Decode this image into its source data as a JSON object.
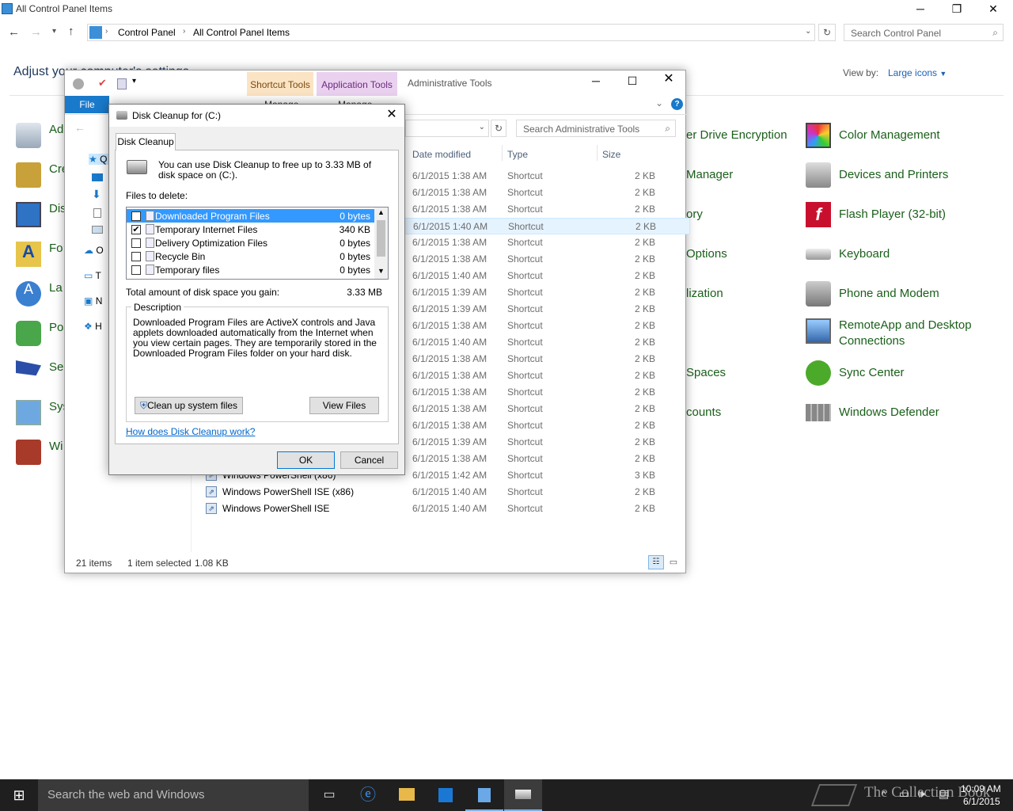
{
  "cp": {
    "title": "All Control Panel Items",
    "breadcrumb": [
      "Control Panel",
      "All Control Panel Items"
    ],
    "search_placeholder": "Search Control Panel",
    "heading": "Adjust your computer's settings",
    "view_by_label": "View by:",
    "view_by_value": "Large icons",
    "left_items": [
      "Ad",
      "Cre",
      "Dis",
      "Fo",
      "La",
      "Po",
      "Se",
      "Sys",
      "Wi"
    ],
    "mid_items": [
      "er Drive Encryption",
      "Manager",
      "ory",
      "Options",
      "lization",
      "Spaces",
      "counts"
    ],
    "right_items": [
      "Color Management",
      "Devices and Printers",
      "Flash Player (32-bit)",
      "Keyboard",
      "Phone and Modem",
      "RemoteApp and Desktop",
      "Connections",
      "Sync Center",
      "Windows Defender"
    ]
  },
  "explorer": {
    "title": "Administrative Tools",
    "tab_shortcut": "Shortcut Tools",
    "tab_app": "Application Tools",
    "file_tab": "File",
    "ribbon_sub1": "Manage",
    "ribbon_sub2": "Manage",
    "search_placeholder": "Search Administrative Tools",
    "columns": {
      "date": "Date modified",
      "type": "Type",
      "size": "Size"
    },
    "nav_letters": [
      "Q",
      "T",
      "N",
      "H",
      "O"
    ],
    "rows": [
      {
        "name": "",
        "date": "6/1/2015 1:38 AM",
        "type": "Shortcut",
        "size": "2 KB"
      },
      {
        "name": "",
        "date": "6/1/2015 1:38 AM",
        "type": "Shortcut",
        "size": "2 KB"
      },
      {
        "name": "",
        "date": "6/1/2015 1:38 AM",
        "type": "Shortcut",
        "size": "2 KB"
      },
      {
        "name": "",
        "date": "6/1/2015 1:40 AM",
        "type": "Shortcut",
        "size": "2 KB"
      },
      {
        "name": "",
        "date": "6/1/2015 1:38 AM",
        "type": "Shortcut",
        "size": "2 KB"
      },
      {
        "name": "",
        "date": "6/1/2015 1:38 AM",
        "type": "Shortcut",
        "size": "2 KB"
      },
      {
        "name": "",
        "date": "6/1/2015 1:40 AM",
        "type": "Shortcut",
        "size": "2 KB"
      },
      {
        "name": "",
        "date": "6/1/2015 1:39 AM",
        "type": "Shortcut",
        "size": "2 KB"
      },
      {
        "name": "",
        "date": "6/1/2015 1:39 AM",
        "type": "Shortcut",
        "size": "2 KB"
      },
      {
        "name": "",
        "date": "6/1/2015 1:38 AM",
        "type": "Shortcut",
        "size": "2 KB"
      },
      {
        "name": "",
        "date": "6/1/2015 1:40 AM",
        "type": "Shortcut",
        "size": "2 KB"
      },
      {
        "name": "",
        "date": "6/1/2015 1:38 AM",
        "type": "Shortcut",
        "size": "2 KB"
      },
      {
        "name": "",
        "date": "6/1/2015 1:38 AM",
        "type": "Shortcut",
        "size": "2 KB"
      },
      {
        "name": "",
        "date": "6/1/2015 1:38 AM",
        "type": "Shortcut",
        "size": "2 KB"
      },
      {
        "name": "",
        "date": "6/1/2015 1:38 AM",
        "type": "Shortcut",
        "size": "2 KB"
      },
      {
        "name": "",
        "date": "6/1/2015 1:38 AM",
        "type": "Shortcut",
        "size": "2 KB"
      },
      {
        "name": "",
        "date": "6/1/2015 1:39 AM",
        "type": "Shortcut",
        "size": "2 KB"
      },
      {
        "name": "",
        "date": "6/1/2015 1:38 AM",
        "type": "Shortcut",
        "size": "2 KB"
      },
      {
        "name": "Windows PowerShell (x86)",
        "date": "6/1/2015 1:42 AM",
        "type": "Shortcut",
        "size": "3 KB"
      },
      {
        "name": "Windows PowerShell ISE (x86)",
        "date": "6/1/2015 1:40 AM",
        "type": "Shortcut",
        "size": "2 KB"
      },
      {
        "name": "Windows PowerShell ISE",
        "date": "6/1/2015 1:40 AM",
        "type": "Shortcut",
        "size": "2 KB"
      }
    ],
    "status_items": "21 items",
    "status_selected": "1 item selected",
    "status_size": "1.08 KB"
  },
  "dlg": {
    "title": "Disk Cleanup for  (C:)",
    "tab": "Disk Cleanup",
    "intro": "You can use Disk Cleanup to free up to 3.33 MB of disk space on  (C:).",
    "files_label": "Files to delete:",
    "files": [
      {
        "name": "Downloaded Program Files",
        "size": "0 bytes",
        "checked": "✔"
      },
      {
        "name": "Temporary Internet Files",
        "size": "340 KB",
        "checked": "✔"
      },
      {
        "name": "Delivery Optimization Files",
        "size": "0 bytes",
        "checked": ""
      },
      {
        "name": "Recycle Bin",
        "size": "0 bytes",
        "checked": ""
      },
      {
        "name": "Temporary files",
        "size": "0 bytes",
        "checked": ""
      }
    ],
    "total_label": "Total amount of disk space you gain:",
    "total_value": "3.33 MB",
    "desc_label": "Description",
    "desc_text": "Downloaded Program Files are ActiveX controls and Java applets downloaded automatically from the Internet when you view certain pages. They are temporarily stored in the Downloaded Program Files folder on your hard disk.",
    "cleanup_btn": "Clean up system files",
    "view_btn": "View Files",
    "help_link": "How does Disk Cleanup work?",
    "ok": "OK",
    "cancel": "Cancel"
  },
  "taskbar": {
    "search": "Search the web and Windows",
    "time": "10:09 AM",
    "date": "6/1/2015",
    "watermark": "The Collection Book"
  }
}
